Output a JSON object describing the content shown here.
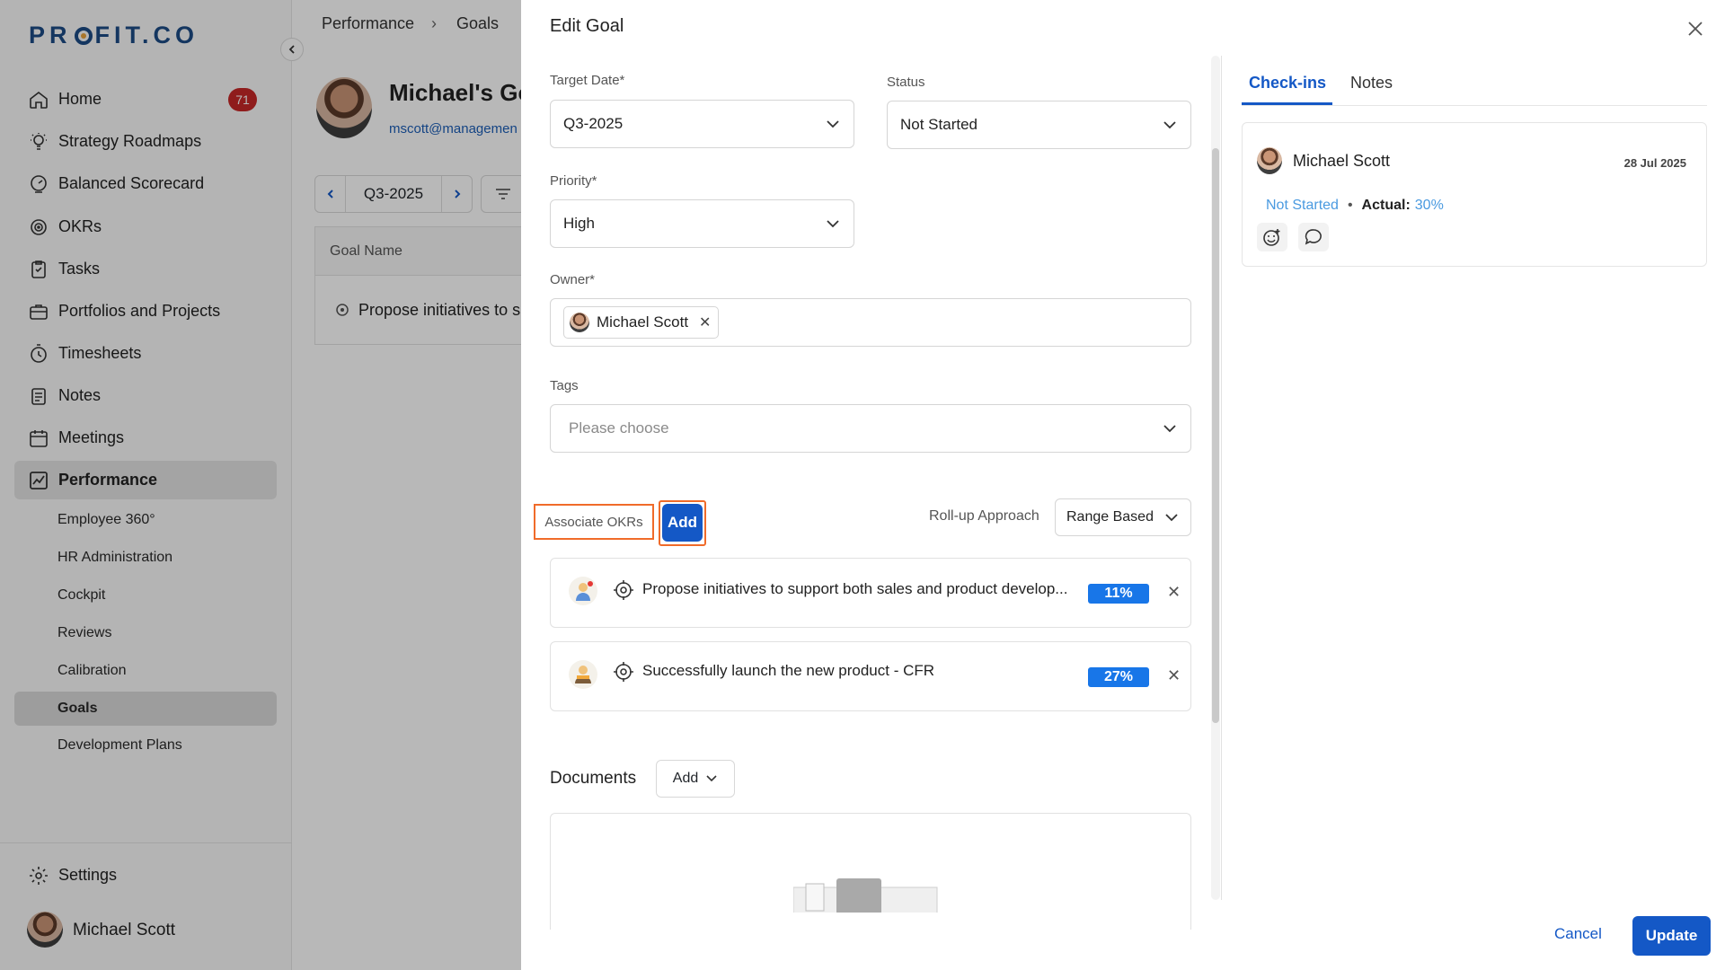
{
  "brand": {
    "logo_text_pre": "PR",
    "logo_text_post": "FIT.CO"
  },
  "sidebar": {
    "items": [
      {
        "label": "Home",
        "icon": "home-icon",
        "badge": "71"
      },
      {
        "label": "Strategy Roadmaps",
        "icon": "lightbulb-icon"
      },
      {
        "label": "Balanced Scorecard",
        "icon": "scorecard-icon"
      },
      {
        "label": "OKRs",
        "icon": "target-icon"
      },
      {
        "label": "Tasks",
        "icon": "task-icon"
      },
      {
        "label": "Portfolios and Projects",
        "icon": "briefcase-icon"
      },
      {
        "label": "Timesheets",
        "icon": "timer-icon"
      },
      {
        "label": "Notes",
        "icon": "notes-icon"
      },
      {
        "label": "Meetings",
        "icon": "calendar-icon"
      },
      {
        "label": "Performance",
        "icon": "performance-icon",
        "active": true
      }
    ],
    "sub_items": [
      {
        "label": "Employee 360°"
      },
      {
        "label": "HR Administration"
      },
      {
        "label": "Cockpit"
      },
      {
        "label": "Reviews"
      },
      {
        "label": "Calibration"
      },
      {
        "label": "Goals",
        "active": true
      },
      {
        "label": "Development Plans"
      }
    ],
    "settings_label": "Settings",
    "user_name": "Michael Scott"
  },
  "background_page": {
    "breadcrumb": [
      "Performance",
      "Goals"
    ],
    "title": "Michael's Go",
    "email": "mscott@managemen",
    "period": "Q3-2025",
    "table_header": "Goal Name",
    "row_text": "Propose initiatives to s"
  },
  "edit_goal": {
    "title": "Edit Goal",
    "target_date": {
      "label": "Target Date*",
      "value": "Q3-2025"
    },
    "status": {
      "label": "Status",
      "value": "Not Started"
    },
    "priority": {
      "label": "Priority*",
      "value": "High"
    },
    "owner": {
      "label": "Owner*",
      "value": "Michael Scott"
    },
    "tags": {
      "label": "Tags",
      "placeholder": "Please choose"
    },
    "associate_label": "Associate OKRs",
    "add_label": "Add",
    "rollup_label": "Roll-up Approach",
    "rollup_value": "Range Based",
    "okrs": [
      {
        "title": "Propose initiatives to support both sales and product develop...",
        "progress": "11%"
      },
      {
        "title": "Successfully launch the new product - CFR",
        "progress": "27%"
      }
    ],
    "documents_label": "Documents",
    "documents_add": "Add",
    "cancel_label": "Cancel",
    "update_label": "Update"
  },
  "side_panel": {
    "tabs": [
      "Check-ins",
      "Notes"
    ],
    "checkin": {
      "user": "Michael Scott",
      "date": "28 Jul 2025",
      "status": "Not Started",
      "actual_label": "Actual:",
      "actual_value": "30%"
    }
  },
  "colors": {
    "accent": "#1458c6",
    "highlight": "#f06b2a",
    "badge": "#c62828",
    "progress": "#1876e8"
  }
}
